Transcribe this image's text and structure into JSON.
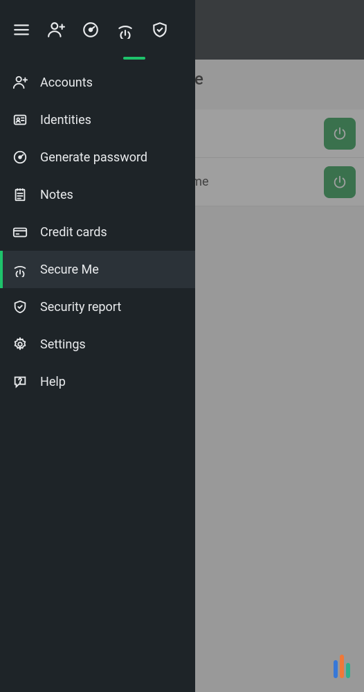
{
  "page": {
    "title_suffix": "Me",
    "rows": [
      {
        "label_suffix": ""
      },
      {
        "label_suffix": "rome"
      }
    ]
  },
  "topbar": {
    "icons": [
      "menu",
      "account",
      "gauge",
      "secure",
      "shield"
    ],
    "active_index": 3
  },
  "menu": {
    "items": [
      {
        "id": "accounts",
        "label": "Accounts",
        "active": false
      },
      {
        "id": "identities",
        "label": "Identities",
        "active": false
      },
      {
        "id": "genpass",
        "label": "Generate password",
        "active": false
      },
      {
        "id": "notes",
        "label": "Notes",
        "active": false
      },
      {
        "id": "cards",
        "label": "Credit cards",
        "active": false
      },
      {
        "id": "secureme",
        "label": "Secure Me",
        "active": true
      },
      {
        "id": "report",
        "label": "Security report",
        "active": false
      },
      {
        "id": "settings",
        "label": "Settings",
        "active": false
      },
      {
        "id": "help",
        "label": "Help",
        "active": false
      }
    ]
  },
  "colors": {
    "accent": "#1ec26b",
    "power": "#1f9a4b",
    "bg": "#1e2428"
  }
}
